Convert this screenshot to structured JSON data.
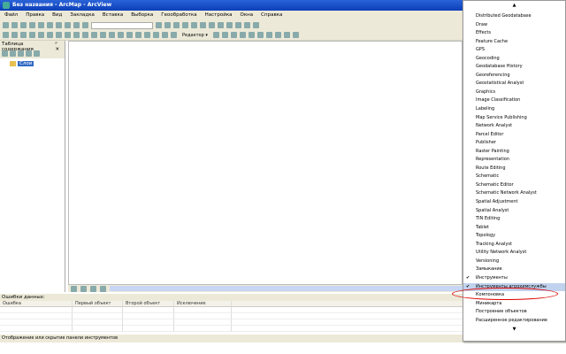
{
  "window": {
    "title": "Без названия - ArcMap - ArcView"
  },
  "menubar": [
    "Файл",
    "Правка",
    "Вид",
    "Закладка",
    "Вставка",
    "Выборка",
    "Геообработка",
    "Настройка",
    "Окна",
    "Справка"
  ],
  "toolbar": {
    "editor_label": "Редактор ▾"
  },
  "toc": {
    "title": "Таблица содержания",
    "pin": "ᵖ",
    "close": "✕",
    "layers_label": "Слои"
  },
  "errors": {
    "title": "Ошибки данных:",
    "columns": [
      "Ошибка",
      "Первый объект",
      "Второй объект",
      "Исключение",
      ""
    ]
  },
  "status": "Отображение или скрытие панели инструментов",
  "menu": {
    "scroll_up": "▲",
    "scroll_down": "▼",
    "items": [
      {
        "label": "Distributed Geodatabase"
      },
      {
        "label": "Draw"
      },
      {
        "label": "Effects"
      },
      {
        "label": "Feature Cache"
      },
      {
        "label": "GPS"
      },
      {
        "label": "Geocoding"
      },
      {
        "label": "Geodatabase History"
      },
      {
        "label": "Georeferencing"
      },
      {
        "label": "Geostatistical Analyst"
      },
      {
        "label": "Graphics"
      },
      {
        "label": "Image Classification"
      },
      {
        "label": "Labeling"
      },
      {
        "label": "Map Service Publishing"
      },
      {
        "label": "Network Analyst"
      },
      {
        "label": "Parcel Editor"
      },
      {
        "label": "Publisher"
      },
      {
        "label": "Raster Painting"
      },
      {
        "label": "Representation"
      },
      {
        "label": "Route Editing"
      },
      {
        "label": "Schematic"
      },
      {
        "label": "Schematic Editor"
      },
      {
        "label": "Schematic Network Analyst"
      },
      {
        "label": "Spatial Adjustment"
      },
      {
        "label": "Spatial Analyst"
      },
      {
        "label": "TIN Editing"
      },
      {
        "label": "Tablet"
      },
      {
        "label": "Topology"
      },
      {
        "label": "Tracking Analyst"
      },
      {
        "label": "Utility Network Analyst"
      },
      {
        "label": "Versioning"
      },
      {
        "label": "Замыкание"
      },
      {
        "label": "Инструменты",
        "checked": true
      },
      {
        "label": "Инструменты агрохимслужбы",
        "checked": true,
        "highlighted": true
      },
      {
        "label": "Компоновка"
      },
      {
        "label": "Миникарта"
      },
      {
        "label": "Построение объектов"
      },
      {
        "label": "Расширенное редактирование"
      }
    ]
  },
  "colors": {
    "highlight": "#c1d2ee",
    "annotation_ring": "#dd0000",
    "title_bar": "#0a3fb8"
  }
}
